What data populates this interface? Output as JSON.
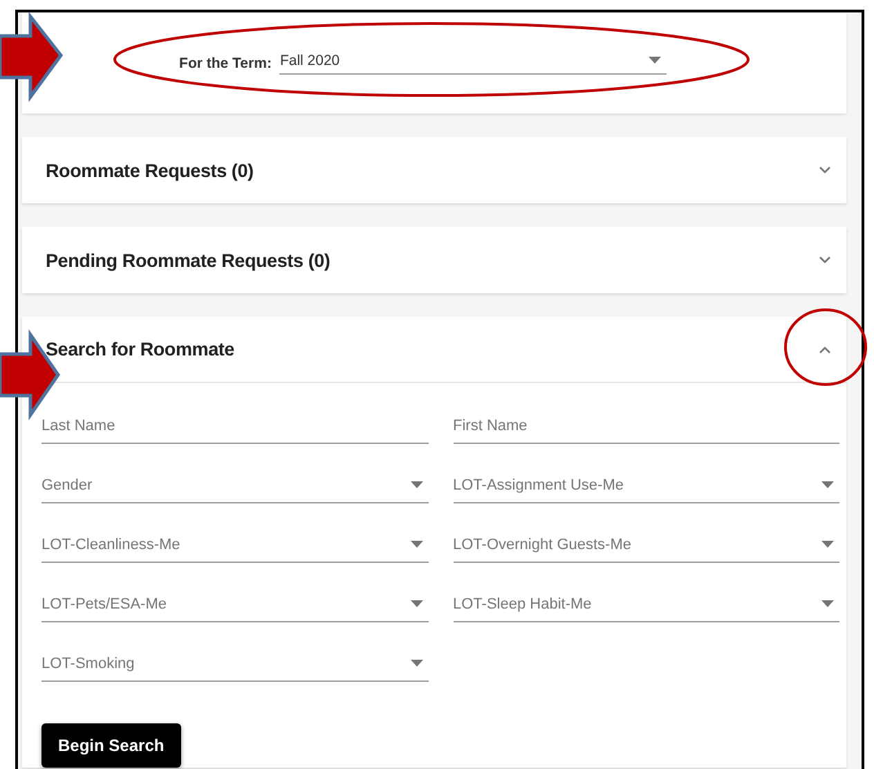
{
  "term": {
    "label": "For the Term:",
    "value": "Fall 2020"
  },
  "panels": [
    {
      "title": "Roommate Requests (0)",
      "expanded": false
    },
    {
      "title": "Pending Roommate Requests (0)",
      "expanded": false
    },
    {
      "title": "Search for Roommate",
      "expanded": true,
      "fields": [
        {
          "label": "Last Name",
          "kind": "text"
        },
        {
          "label": "First Name",
          "kind": "text"
        },
        {
          "label": "Gender",
          "kind": "select"
        },
        {
          "label": "LOT-Assignment Use-Me",
          "kind": "select"
        },
        {
          "label": "LOT-Cleanliness-Me",
          "kind": "select"
        },
        {
          "label": "LOT-Overnight Guests-Me",
          "kind": "select"
        },
        {
          "label": "LOT-Pets/ESA-Me",
          "kind": "select"
        },
        {
          "label": "LOT-Sleep Habit-Me",
          "kind": "select"
        },
        {
          "label": "LOT-Smoking",
          "kind": "select"
        }
      ],
      "button": "Begin Search"
    }
  ]
}
